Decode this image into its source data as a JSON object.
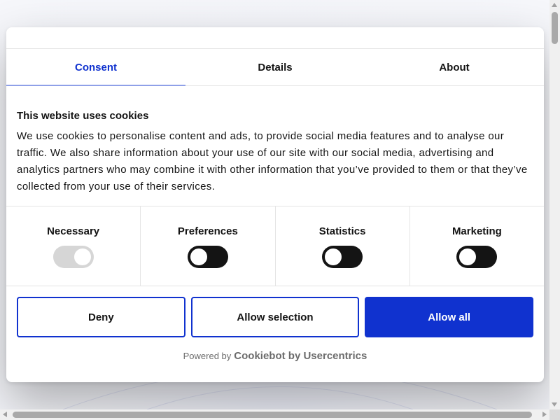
{
  "tabs": [
    {
      "label": "Consent",
      "active": true
    },
    {
      "label": "Details",
      "active": false
    },
    {
      "label": "About",
      "active": false
    }
  ],
  "content": {
    "heading": "This website uses cookies",
    "body": "We use cookies to personalise content and ads, to provide social media features and to analyse our traffic. We also share information about your use of our site with our social media, advertising and analytics partners who may combine it with other information that you’ve provided to them or that they’ve collected from your use of their services."
  },
  "categories": [
    {
      "label": "Necessary",
      "checked": true,
      "disabled": true
    },
    {
      "label": "Preferences",
      "checked": false,
      "disabled": false
    },
    {
      "label": "Statistics",
      "checked": false,
      "disabled": false
    },
    {
      "label": "Marketing",
      "checked": false,
      "disabled": false
    }
  ],
  "buttons": {
    "deny": "Deny",
    "allow_selection": "Allow selection",
    "allow_all": "Allow all"
  },
  "footer": {
    "powered_by": "Powered by",
    "brand": "Cookiebot by Usercentrics"
  },
  "colors": {
    "accent": "#1032cf",
    "text": "#141414",
    "toggle_off": "#141414",
    "toggle_disabled": "#d6d6d6"
  },
  "icons": [
    "scroll-up-arrow-icon",
    "scroll-down-arrow-icon",
    "scroll-left-arrow-icon",
    "scroll-right-arrow-icon"
  ]
}
